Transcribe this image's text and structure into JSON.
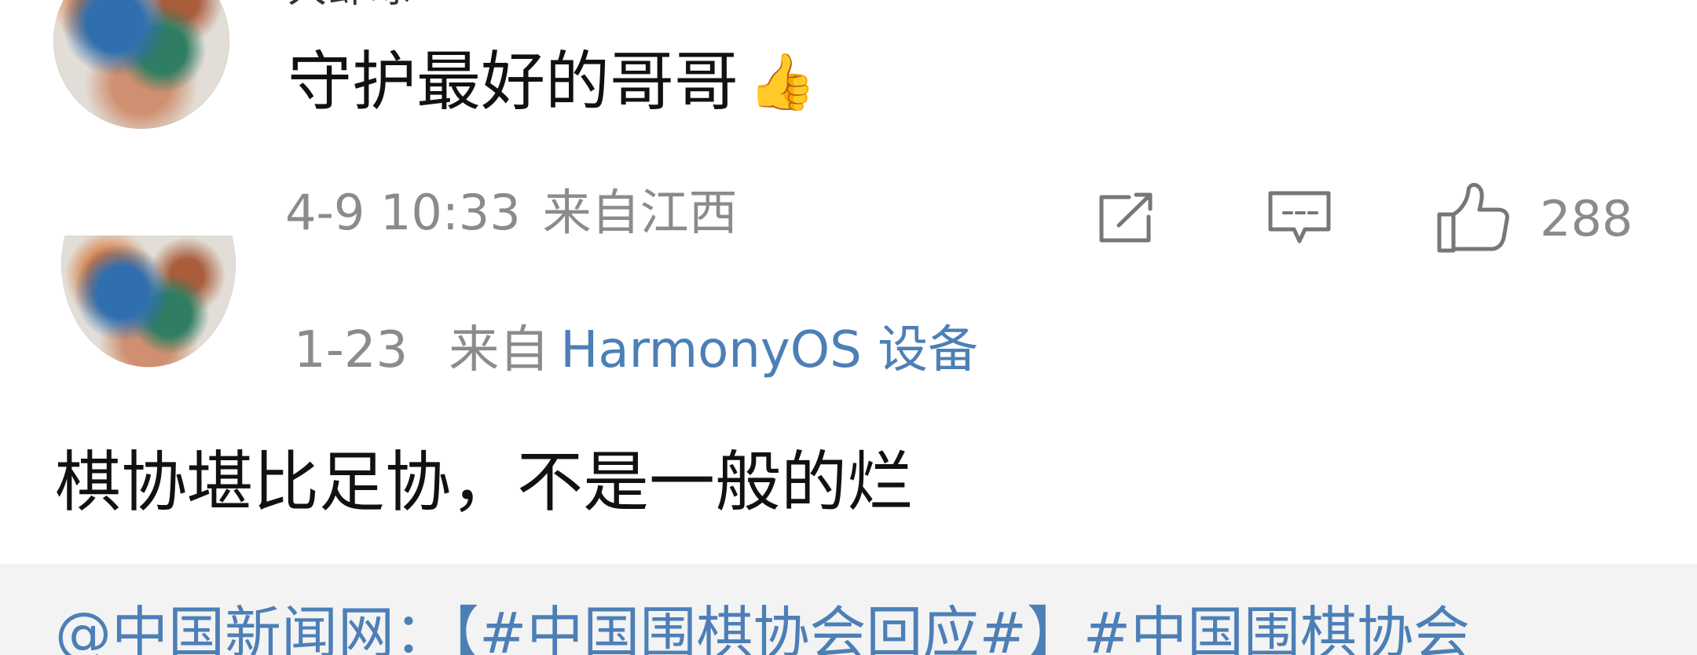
{
  "comment": {
    "name_partial": "大虾球",
    "text": "守护最好的哥哥",
    "emoji": "👍",
    "time": "4-9 10:33",
    "location": "来自江西",
    "likes": "288",
    "icons": {
      "repost": "repost-icon",
      "reply": "reply-icon",
      "like": "like-icon"
    }
  },
  "post": {
    "date": "1-23",
    "from_label": "来自",
    "device": "HarmonyOS 设备",
    "text": "棋协堪比足协，不是一般的烂"
  },
  "quote": {
    "author": "@中国新闻网",
    "separator": "：【",
    "topic_1": "#中国围棋协会回应#",
    "separator_2": "】",
    "topic_2": "#中国围棋协会"
  },
  "colors": {
    "link": "#4d7fb7",
    "meta": "#8b8b8b",
    "text": "#111111",
    "quote_background": "#f3f3f3"
  }
}
